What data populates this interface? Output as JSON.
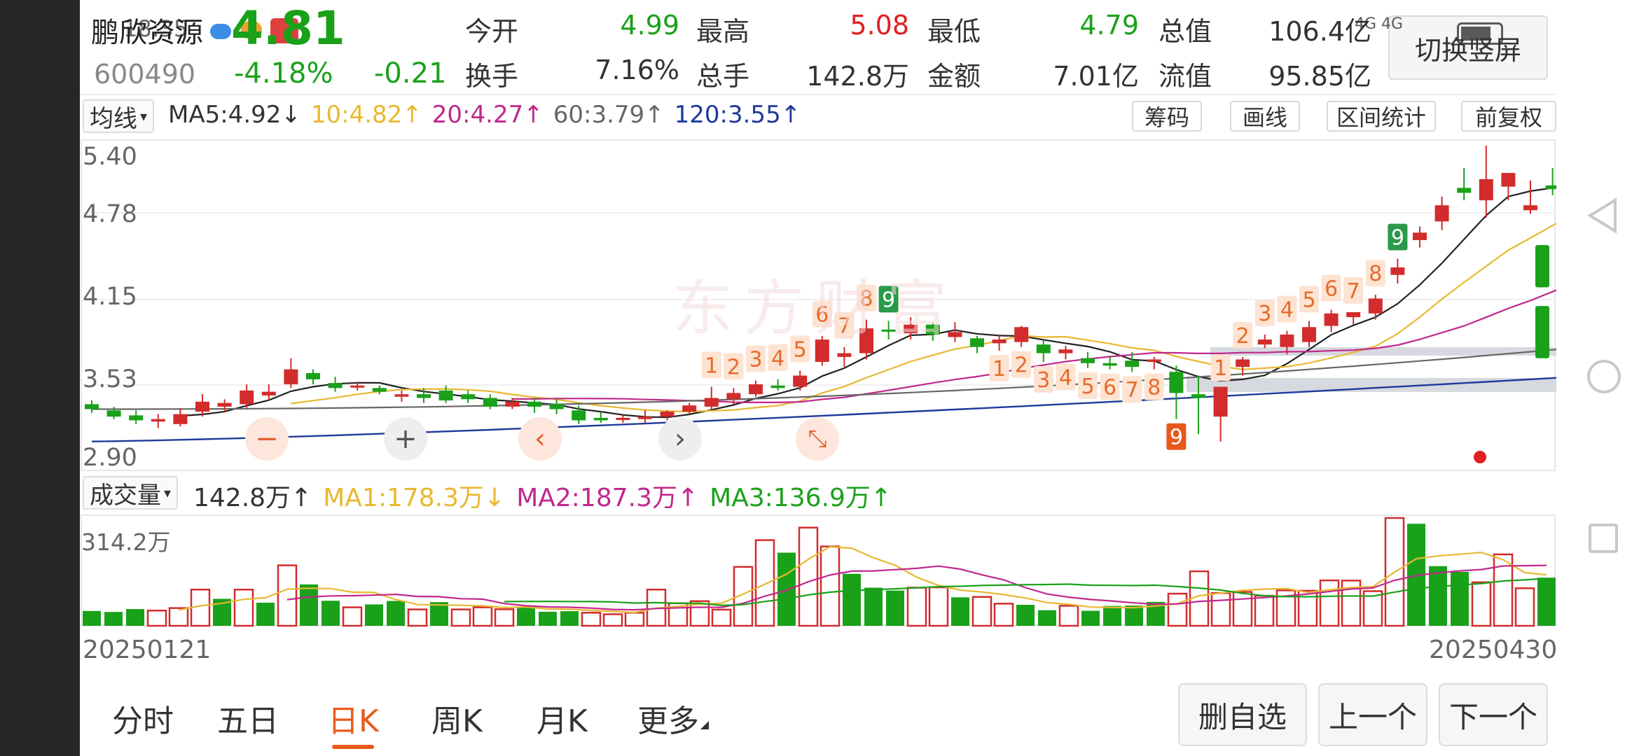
{
  "status_bar": {
    "time": "18:35",
    "network": "4G 4G"
  },
  "header": {
    "name": "鹏欣资源",
    "price": "4.81",
    "code": "600490",
    "pct": "-4.18%",
    "chg": "-0.21",
    "stats": [
      {
        "label": "今开",
        "value": "4.99",
        "color": "#1aa11a"
      },
      {
        "label": "最高",
        "value": "5.08",
        "color": "#e02020"
      },
      {
        "label": "最低",
        "value": "4.79",
        "color": "#1aa11a"
      },
      {
        "label": "总值",
        "value": "106.4亿",
        "color": "#333333"
      },
      {
        "label": "换手",
        "value": "7.16%",
        "color": "#333333"
      },
      {
        "label": "总手",
        "value": "142.8万",
        "color": "#333333"
      },
      {
        "label": "金额",
        "value": "7.01亿",
        "color": "#333333"
      },
      {
        "label": "流值",
        "value": "95.85亿",
        "color": "#333333"
      }
    ],
    "switch_label": "切换竖屏"
  },
  "ma_bar": {
    "dropdown": "均线",
    "items": [
      {
        "text": "MA5:4.92↓",
        "color": "#333333"
      },
      {
        "text": "10:4.82↑",
        "color": "#e8b830"
      },
      {
        "text": "20:4.27↑",
        "color": "#c0288c"
      },
      {
        "text": "60:3.79↑",
        "color": "#666666"
      },
      {
        "text": "120:3.55↑",
        "color": "#1e3a9a"
      }
    ],
    "tools": [
      "筹码",
      "画线",
      "区间统计",
      "前复权"
    ]
  },
  "watermark": "东方财富",
  "price_axis": [
    "5.40",
    "4.78",
    "4.15",
    "3.53",
    "2.90"
  ],
  "vol_bar": {
    "dropdown": "成交量",
    "items": [
      {
        "text": "142.8万↑",
        "color": "#333333"
      },
      {
        "text": "MA1:178.3万↓",
        "color": "#e8b830"
      },
      {
        "text": "MA2:187.3万↑",
        "color": "#c0288c"
      },
      {
        "text": "MA3:136.9万↑",
        "color": "#1aa11a"
      }
    ]
  },
  "vol_axis": "314.2万",
  "dates": {
    "start": "20250121",
    "end": "20250430"
  },
  "tabs": [
    "分时",
    "五日",
    "日K",
    "周K",
    "月K",
    "更多"
  ],
  "active_tab": "日K",
  "actions": [
    "删自选",
    "上一个",
    "下一个"
  ],
  "colors": {
    "up": "#d22c2c",
    "down": "#1aa11a",
    "bg": "#ffffff"
  },
  "chart_data": {
    "type": "candlestick",
    "ylim": [
      2.9,
      5.4
    ],
    "ohlc": [
      [
        3.32,
        3.35,
        3.25,
        3.28
      ],
      [
        3.27,
        3.3,
        3.2,
        3.22
      ],
      [
        3.23,
        3.27,
        3.16,
        3.19
      ],
      [
        3.18,
        3.24,
        3.13,
        3.2
      ],
      [
        3.16,
        3.29,
        3.14,
        3.24
      ],
      [
        3.26,
        3.4,
        3.22,
        3.34
      ],
      [
        3.3,
        3.36,
        3.26,
        3.33
      ],
      [
        3.32,
        3.48,
        3.29,
        3.43
      ],
      [
        3.39,
        3.48,
        3.35,
        3.42
      ],
      [
        3.48,
        3.69,
        3.45,
        3.6
      ],
      [
        3.57,
        3.6,
        3.48,
        3.52
      ],
      [
        3.49,
        3.54,
        3.42,
        3.45
      ],
      [
        3.46,
        3.5,
        3.43,
        3.47
      ],
      [
        3.45,
        3.47,
        3.4,
        3.42
      ],
      [
        3.38,
        3.43,
        3.34,
        3.4
      ],
      [
        3.4,
        3.45,
        3.33,
        3.37
      ],
      [
        3.43,
        3.47,
        3.33,
        3.35
      ],
      [
        3.4,
        3.43,
        3.33,
        3.36
      ],
      [
        3.37,
        3.4,
        3.28,
        3.3
      ],
      [
        3.3,
        3.37,
        3.28,
        3.34
      ],
      [
        3.34,
        3.37,
        3.25,
        3.3
      ],
      [
        3.32,
        3.36,
        3.24,
        3.28
      ],
      [
        3.27,
        3.31,
        3.16,
        3.19
      ],
      [
        3.21,
        3.26,
        3.17,
        3.19
      ],
      [
        3.2,
        3.23,
        3.17,
        3.21
      ],
      [
        3.2,
        3.27,
        3.17,
        3.22
      ],
      [
        3.22,
        3.27,
        3.19,
        3.26
      ],
      [
        3.26,
        3.33,
        3.24,
        3.31
      ],
      [
        3.3,
        3.46,
        3.28,
        3.37
      ],
      [
        3.36,
        3.45,
        3.32,
        3.41
      ],
      [
        3.4,
        3.51,
        3.38,
        3.48
      ],
      [
        3.47,
        3.52,
        3.43,
        3.45
      ],
      [
        3.46,
        3.59,
        3.43,
        3.55
      ],
      [
        3.66,
        3.87,
        3.63,
        3.84
      ],
      [
        3.7,
        3.78,
        3.62,
        3.73
      ],
      [
        3.73,
        4.0,
        3.68,
        3.93
      ],
      [
        3.92,
        3.99,
        3.84,
        3.91
      ],
      [
        3.89,
        4.02,
        3.84,
        3.96
      ],
      [
        3.96,
        3.97,
        3.83,
        3.88
      ],
      [
        3.86,
        3.98,
        3.82,
        3.9
      ],
      [
        3.85,
        3.87,
        3.73,
        3.78
      ],
      [
        3.81,
        3.88,
        3.75,
        3.84
      ],
      [
        3.82,
        3.95,
        3.78,
        3.94
      ],
      [
        3.8,
        3.83,
        3.66,
        3.73
      ],
      [
        3.73,
        3.79,
        3.68,
        3.76
      ],
      [
        3.69,
        3.74,
        3.61,
        3.65
      ],
      [
        3.65,
        3.71,
        3.6,
        3.63
      ],
      [
        3.67,
        3.74,
        3.58,
        3.62
      ],
      [
        3.66,
        3.7,
        3.6,
        3.68
      ],
      [
        3.58,
        3.63,
        3.2,
        3.41
      ],
      [
        3.4,
        3.55,
        3.08,
        3.37
      ],
      [
        3.22,
        3.44,
        3.02,
        3.46
      ],
      [
        3.62,
        3.7,
        3.55,
        3.68
      ],
      [
        3.8,
        3.88,
        3.77,
        3.84
      ],
      [
        3.78,
        3.91,
        3.72,
        3.88
      ],
      [
        3.82,
        3.99,
        3.78,
        3.94
      ],
      [
        3.95,
        4.08,
        3.9,
        4.05
      ],
      [
        4.02,
        4.06,
        3.96,
        4.06
      ],
      [
        4.05,
        4.2,
        4.0,
        4.17
      ],
      [
        4.36,
        4.49,
        4.29,
        4.42
      ],
      [
        4.64,
        4.75,
        4.58,
        4.7
      ],
      [
        4.79,
        4.99,
        4.72,
        4.92
      ],
      [
        5.06,
        5.22,
        4.96,
        5.02
      ],
      [
        4.96,
        5.4,
        4.82,
        5.13
      ],
      [
        5.07,
        5.13,
        4.96,
        5.18
      ],
      [
        4.88,
        5.12,
        4.85,
        4.92
      ],
      [
        5.08,
        5.22,
        5.0,
        5.05
      ],
      [
        5.01,
        5.16,
        4.93,
        5.07
      ],
      [
        4.99,
        5.08,
        4.79,
        4.81
      ]
    ],
    "tail_ohlc": [
      [
        4.6,
        4.64,
        4.21,
        4.26
      ],
      [
        4.11,
        4.18,
        3.66,
        3.69
      ]
    ],
    "volume_max": 314.2,
    "volume": [
      [
        77,
        0
      ],
      [
        72,
        0
      ],
      [
        87,
        0
      ],
      [
        79,
        1
      ],
      [
        92,
        1
      ],
      [
        188,
        1
      ],
      [
        140,
        0
      ],
      [
        188,
        1
      ],
      [
        120,
        0
      ],
      [
        314,
        1
      ],
      [
        215,
        0
      ],
      [
        130,
        0
      ],
      [
        96,
        1
      ],
      [
        111,
        0
      ],
      [
        129,
        0
      ],
      [
        85,
        1
      ],
      [
        123,
        0
      ],
      [
        85,
        1
      ],
      [
        96,
        1
      ],
      [
        86,
        1
      ],
      [
        98,
        0
      ],
      [
        73,
        0
      ],
      [
        76,
        0
      ],
      [
        68,
        1
      ],
      [
        60,
        1
      ],
      [
        68,
        1
      ],
      [
        188,
        1
      ],
      [
        117,
        1
      ],
      [
        128,
        1
      ],
      [
        84,
        1
      ],
      [
        306,
        1
      ],
      [
        445,
        1
      ],
      [
        380,
        0
      ],
      [
        510,
        1
      ],
      [
        412,
        1
      ],
      [
        270,
        0
      ],
      [
        198,
        0
      ],
      [
        183,
        0
      ],
      [
        198,
        1
      ],
      [
        200,
        1
      ],
      [
        148,
        0
      ],
      [
        150,
        1
      ],
      [
        115,
        1
      ],
      [
        109,
        0
      ],
      [
        81,
        0
      ],
      [
        104,
        1
      ],
      [
        78,
        0
      ],
      [
        103,
        0
      ],
      [
        105,
        0
      ],
      [
        124,
        0
      ],
      [
        167,
        1
      ],
      [
        283,
        1
      ],
      [
        170,
        1
      ],
      [
        176,
        1
      ],
      [
        156,
        1
      ],
      [
        184,
        1
      ],
      [
        182,
        1
      ],
      [
        236,
        1
      ],
      [
        235,
        1
      ],
      [
        180,
        1
      ],
      [
        560,
        1
      ],
      [
        530,
        0
      ],
      [
        310,
        0
      ],
      [
        280,
        0
      ],
      [
        226,
        1
      ],
      [
        371,
        1
      ],
      [
        195,
        1
      ],
      [
        250,
        0
      ]
    ]
  }
}
